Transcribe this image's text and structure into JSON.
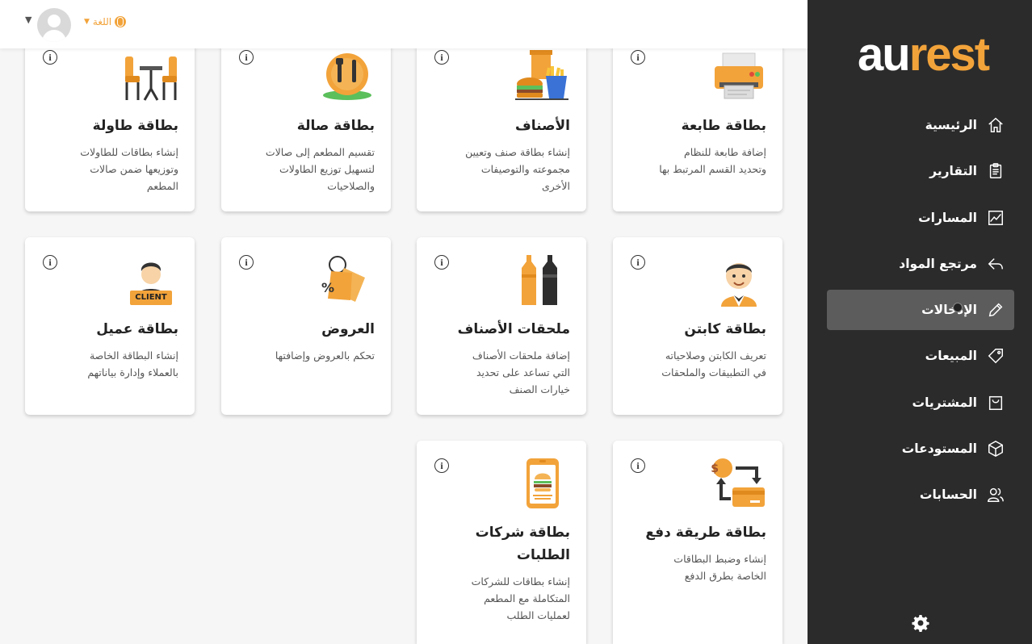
{
  "brand": {
    "part1": "au",
    "part2": "rest"
  },
  "header": {
    "language_label": "اللغة"
  },
  "sidebar": {
    "items": [
      {
        "label": "الرئيسية",
        "icon": "home-icon"
      },
      {
        "label": "التقارير",
        "icon": "clipboard-icon"
      },
      {
        "label": "المسارات",
        "icon": "chart-line-icon"
      },
      {
        "label": "مرتجع المواد",
        "icon": "return-arrow-icon"
      },
      {
        "label": "الإدخالات",
        "icon": "pencil-icon",
        "active": true
      },
      {
        "label": "المبيعات",
        "icon": "tag-icon"
      },
      {
        "label": "المشتريات",
        "icon": "shopping-bag-icon"
      },
      {
        "label": "المستودعات",
        "icon": "box-icon"
      },
      {
        "label": "الحسابات",
        "icon": "users-icon"
      }
    ]
  },
  "cards": [
    {
      "title": "بطاقة طابعة",
      "desc": [
        "إضافة طابعة للنظام",
        "وتحديد القسم المرتبط بها"
      ],
      "icon": "printer-icon"
    },
    {
      "title": "الأصناف",
      "desc": [
        "إنشاء بطاقة صنف وتعيين",
        "مجموعته والتوصيفات",
        "الأخرى"
      ],
      "icon": "fast-food-icon"
    },
    {
      "title": "بطاقة صالة",
      "desc": [
        "تقسيم المطعم إلى صالات",
        "لتسهيل توزيع الطاولات",
        "والصلاحيات"
      ],
      "icon": "dish-icon"
    },
    {
      "title": "بطاقة طاولة",
      "desc": [
        "إنشاء بطاقات للطاولات",
        "وتوزيعها ضمن صالات",
        "المطعم"
      ],
      "icon": "table-chairs-icon"
    },
    {
      "title": "بطاقة كابتن",
      "desc": [
        "تعريف الكابتن وصلاحياته",
        "في التطبيقات والملحقات"
      ],
      "icon": "waiter-icon"
    },
    {
      "title": "ملحقات الأصناف",
      "desc": [
        "إضافة ملحقات الأصناف",
        "التي تساعد على تحديد",
        "خيارات الصنف"
      ],
      "icon": "sauce-bottles-icon"
    },
    {
      "title": "العروض",
      "desc": [
        "تحكم بالعروض وإضافتها"
      ],
      "icon": "discount-tag-icon"
    },
    {
      "title": "بطاقة عميل",
      "desc": [
        "إنشاء البطاقة الخاصة",
        "بالعملاء وإدارة بياناتهم"
      ],
      "icon": "client-icon",
      "badge": "CLIENT"
    },
    {
      "title": "بطاقة طريقة دفع",
      "desc": [
        "إنشاء وضبط البطاقات",
        "الخاصة بطرق الدفع"
      ],
      "icon": "payment-exchange-icon"
    },
    {
      "title_lines": [
        "بطاقة شركات",
        "الطلبات"
      ],
      "desc": [
        "إنشاء بطاقات للشركات",
        "المتكاملة مع المطعم",
        "لعمليات الطلب"
      ],
      "icon": "delivery-app-icon"
    }
  ]
}
